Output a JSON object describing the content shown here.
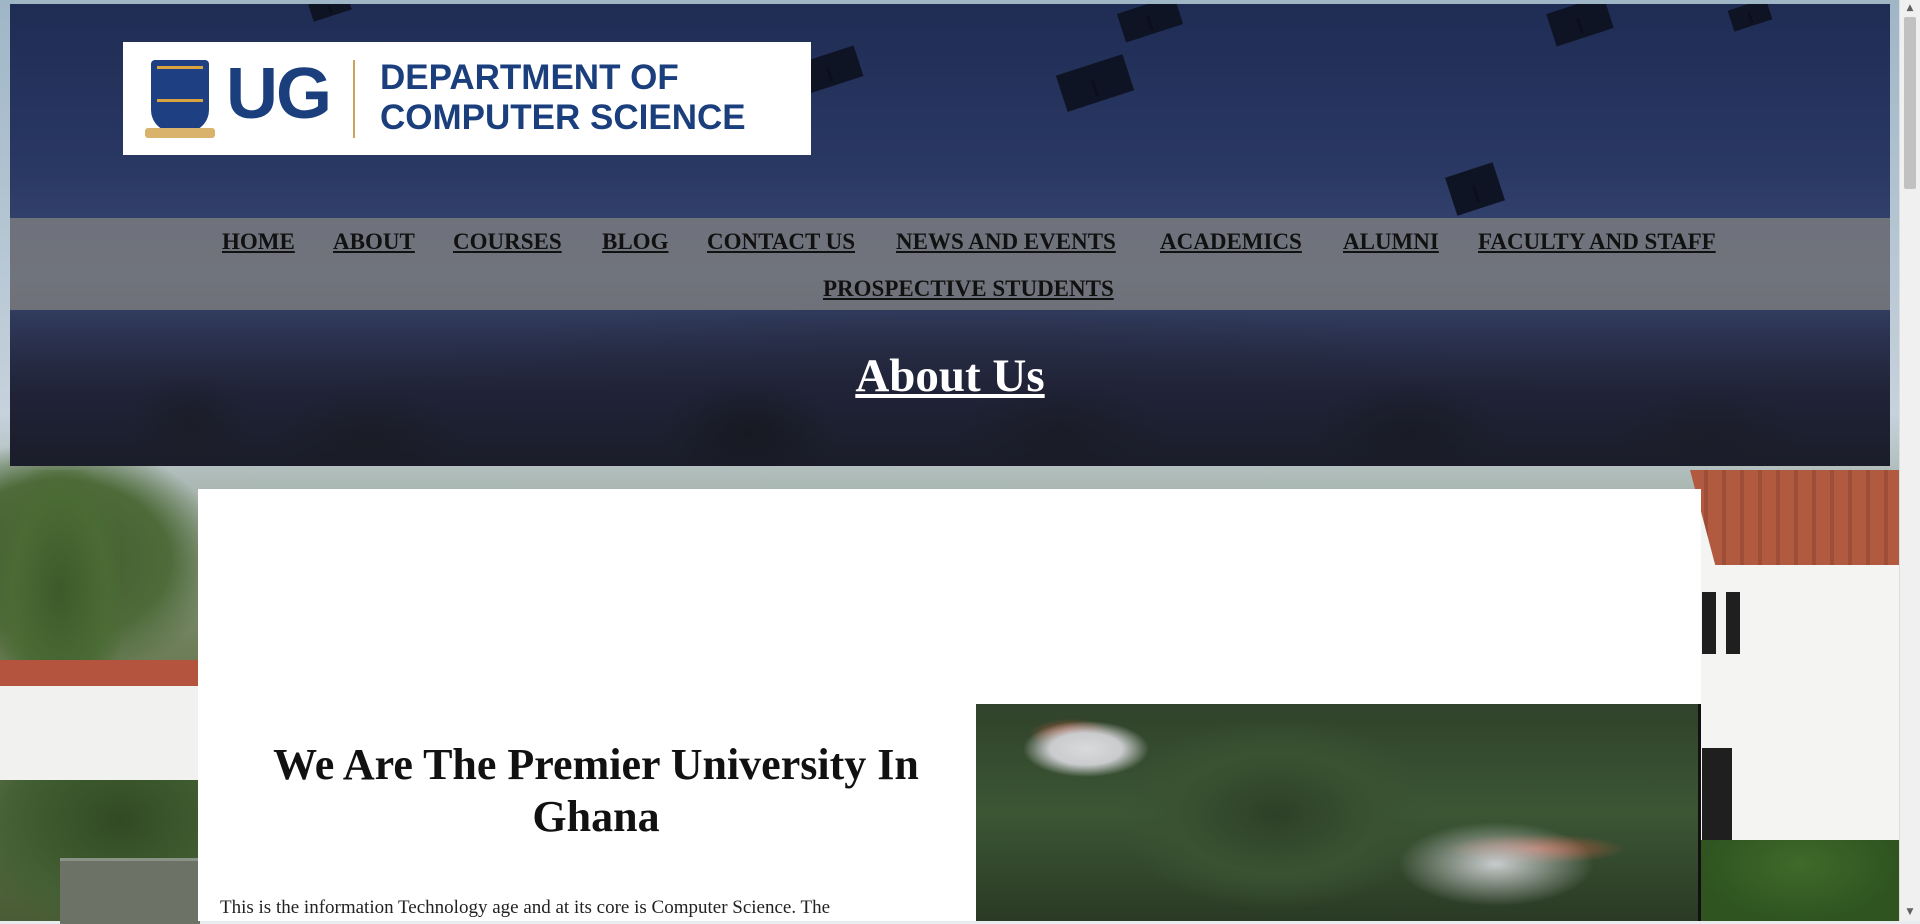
{
  "header": {
    "logo": {
      "mark": "UG",
      "department_line1": "DEPARTMENT OF",
      "department_line2": "COMPUTER SCIENCE"
    }
  },
  "nav": {
    "items": [
      {
        "label": "HOME"
      },
      {
        "label": "ABOUT"
      },
      {
        "label": "COURSES"
      },
      {
        "label": "BLOG"
      },
      {
        "label": "CONTACT US"
      },
      {
        "label": "NEWS AND EVENTS"
      },
      {
        "label": "ACADEMICS"
      },
      {
        "label": "ALUMNI"
      },
      {
        "label": "FACULTY AND STAFF"
      },
      {
        "label": "PROSPECTIVE STUDENTS"
      }
    ]
  },
  "hero": {
    "title": "About Us"
  },
  "content": {
    "heading": "We Are The Premier University In Ghana",
    "body": "This is the information Technology age and at its core is Computer Science. The"
  },
  "theme": {
    "hero_overlay": "#25345e",
    "nav_band": "#808080",
    "logo_blue": "#1b3f7c",
    "logo_gold": "#c9a45a",
    "card_bg": "#ffffff"
  },
  "icons": {
    "crest": "university-crest-icon",
    "scroll_up": "scroll-up-arrow-icon",
    "scroll_down": "scroll-down-arrow-icon"
  }
}
